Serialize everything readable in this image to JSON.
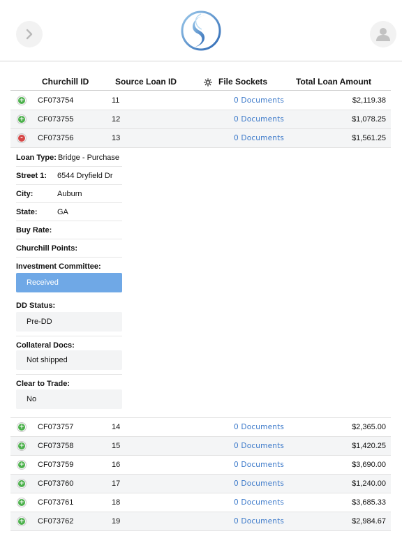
{
  "header": {
    "back_icon": "chevron-right-icon",
    "logo_icon": "swirl-logo-icon",
    "profile_icon": "user-icon"
  },
  "table": {
    "columns": {
      "churchill_id": "Churchill ID",
      "source_loan_id": "Source Loan ID",
      "file_sockets": "File Sockets",
      "total_loan_amount": "Total Loan Amount"
    },
    "rows_top": [
      {
        "churchill_id": "CF073754",
        "source_loan_id": "11",
        "documents": "0 Documents",
        "amount": "$2,119.38",
        "toggle": "+"
      },
      {
        "churchill_id": "CF073755",
        "source_loan_id": "12",
        "documents": "0 Documents",
        "amount": "$1,078.25",
        "toggle": "+"
      },
      {
        "churchill_id": "CF073756",
        "source_loan_id": "13",
        "documents": "0 Documents",
        "amount": "$1,561.25",
        "toggle": "-"
      }
    ],
    "rows_bottom": [
      {
        "churchill_id": "CF073757",
        "source_loan_id": "14",
        "documents": "0 Documents",
        "amount": "$2,365.00",
        "toggle": "+"
      },
      {
        "churchill_id": "CF073758",
        "source_loan_id": "15",
        "documents": "0 Documents",
        "amount": "$1,420.25",
        "toggle": "+"
      },
      {
        "churchill_id": "CF073759",
        "source_loan_id": "16",
        "documents": "0 Documents",
        "amount": "$3,690.00",
        "toggle": "+"
      },
      {
        "churchill_id": "CF073760",
        "source_loan_id": "17",
        "documents": "0 Documents",
        "amount": "$1,240.00",
        "toggle": "+"
      },
      {
        "churchill_id": "CF073761",
        "source_loan_id": "18",
        "documents": "0 Documents",
        "amount": "$3,685.33",
        "toggle": "+"
      },
      {
        "churchill_id": "CF073762",
        "source_loan_id": "19",
        "documents": "0 Documents",
        "amount": "$2,984.67",
        "toggle": "+"
      }
    ]
  },
  "detail": {
    "loan_type_label": "Loan Type:",
    "loan_type_value": "Bridge - Purchase",
    "street_label": "Street 1:",
    "street_value": "6544 Dryfield Dr",
    "city_label": "City:",
    "city_value": "Auburn",
    "state_label": "State:",
    "state_value": "GA",
    "buy_rate_label": "Buy Rate:",
    "churchill_points_label": "Churchill Points:",
    "investment_committee_label": "Investment Committee:",
    "investment_committee_value": "Received",
    "dd_status_label": "DD Status:",
    "dd_status_value": "Pre-DD",
    "collateral_docs_label": "Collateral Docs:",
    "collateral_docs_value": "Not shipped",
    "clear_to_trade_label": "Clear to Trade:",
    "clear_to_trade_value": "No"
  },
  "colors": {
    "link": "#3a78c9",
    "expand": "#4bb04b",
    "collapse": "#d64747",
    "received": "#6fa8e6"
  }
}
